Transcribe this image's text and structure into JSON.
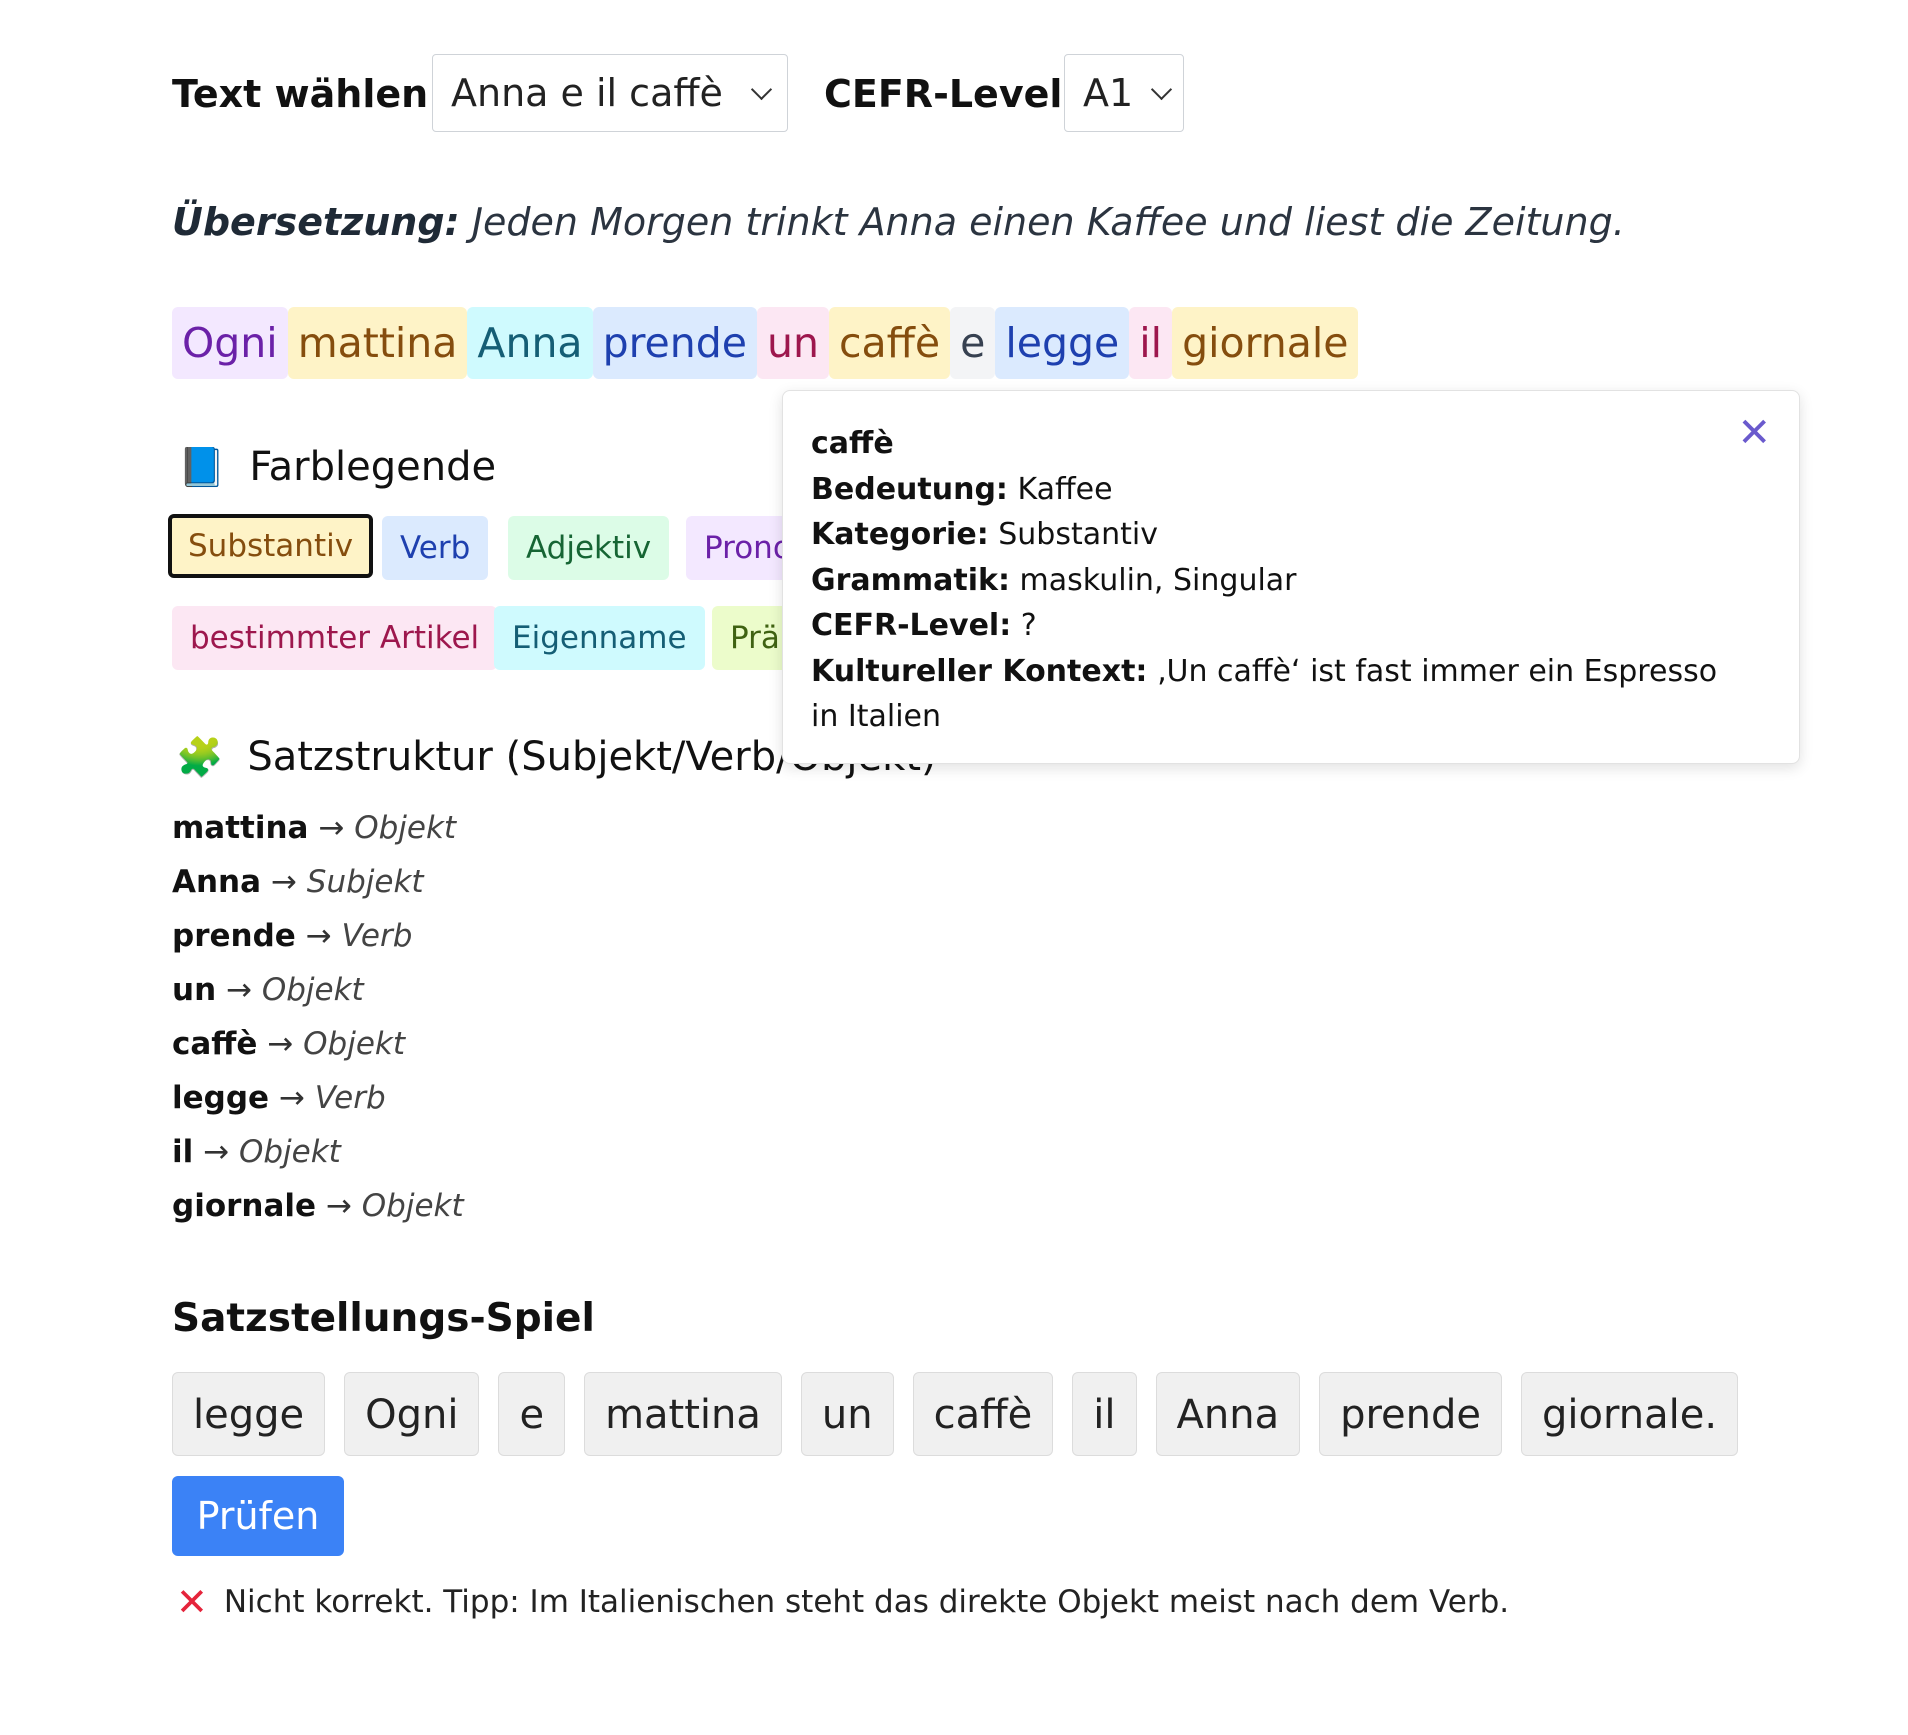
{
  "controls": {
    "text_label": "Text wählen:",
    "text_value": "Anna e il caffè",
    "cefr_label": "CEFR-Level:",
    "cefr_value": "A1"
  },
  "translation": {
    "label": "Übersetzung:",
    "text": "Jeden Morgen trinkt Anna einen Kaffee und liest die Zeitung."
  },
  "sentence": [
    {
      "word": "Ogni",
      "bg": "#f3e8ff",
      "fg": "#6b21a8"
    },
    {
      "word": "mattina",
      "bg": "#fef3c7",
      "fg": "#854d0e"
    },
    {
      "word": "Anna",
      "bg": "#cffafe",
      "fg": "#155e75"
    },
    {
      "word": "prende",
      "bg": "#dbeafe",
      "fg": "#1e40af"
    },
    {
      "word": "un",
      "bg": "#fce7f3",
      "fg": "#9d174d"
    },
    {
      "word": "caffè",
      "bg": "#fef3c7",
      "fg": "#854d0e"
    },
    {
      "word": "e",
      "bg": "#f3f4f6",
      "fg": "#374151"
    },
    {
      "word": "legge",
      "bg": "#dbeafe",
      "fg": "#1e40af"
    },
    {
      "word": "il",
      "bg": "#fce7f3",
      "fg": "#9d174d"
    },
    {
      "word": "giornale",
      "bg": "#fef3c7",
      "fg": "#854d0e"
    }
  ],
  "legend": {
    "icon": "blue-book-icon",
    "emoji": "📘",
    "title": "Farblegende",
    "chips": {
      "substantiv": {
        "label": "Substantiv",
        "bg": "#fef3c7",
        "fg": "#854d0e"
      },
      "verb": {
        "label": "Verb",
        "bg": "#dbeafe",
        "fg": "#1e40af"
      },
      "adjektiv": {
        "label": "Adjektiv",
        "bg": "#dcfce7",
        "fg": "#166534"
      },
      "pronomen": {
        "label": "Prono",
        "bg": "#f3e8ff",
        "fg": "#6b21a8"
      },
      "artikel": {
        "label": "bestimmter Artikel",
        "bg": "#fce7f3",
        "fg": "#9d174d"
      },
      "eigenname": {
        "label": "Eigenname",
        "bg": "#cffafe",
        "fg": "#155e75"
      },
      "praeposition": {
        "label": "Prä",
        "bg": "#ecfccb",
        "fg": "#3f6212"
      }
    }
  },
  "structure": {
    "icon": "puzzle-icon",
    "emoji": "🧩",
    "title": "Satzstruktur (Subjekt/Verb/Objekt)",
    "rows": [
      {
        "word": "mattina",
        "role": "Objekt"
      },
      {
        "word": "Anna",
        "role": "Subjekt"
      },
      {
        "word": "prende",
        "role": "Verb"
      },
      {
        "word": "un",
        "role": "Objekt"
      },
      {
        "word": "caffè",
        "role": "Objekt"
      },
      {
        "word": "legge",
        "role": "Verb"
      },
      {
        "word": "il",
        "role": "Objekt"
      },
      {
        "word": "giornale",
        "role": "Objekt"
      }
    ],
    "arrow": "→"
  },
  "game": {
    "title": "Satzstellungs-Spiel",
    "words": [
      "legge",
      "Ogni",
      "e",
      "mattina",
      "un",
      "caffè",
      "il",
      "Anna",
      "prende",
      "giornale."
    ],
    "check_label": "Prüfen",
    "feedback_icon": "cross-mark-icon",
    "feedback_text": "Nicht korrekt. Tipp: Im Italienischen steht das direkte Objekt meist nach dem Verb."
  },
  "popover": {
    "word": "caffè",
    "meaning_label": "Bedeutung:",
    "meaning": "Kaffee",
    "category_label": "Kategorie:",
    "category": "Substantiv",
    "grammar_label": "Grammatik:",
    "grammar": "maskulin, Singular",
    "cefr_label": "CEFR-Level:",
    "cefr": "?",
    "culture_label": "Kultureller Kontext:",
    "culture": "‚Un caffè‘ ist fast immer ein Espresso in Italien",
    "close": "✕"
  }
}
